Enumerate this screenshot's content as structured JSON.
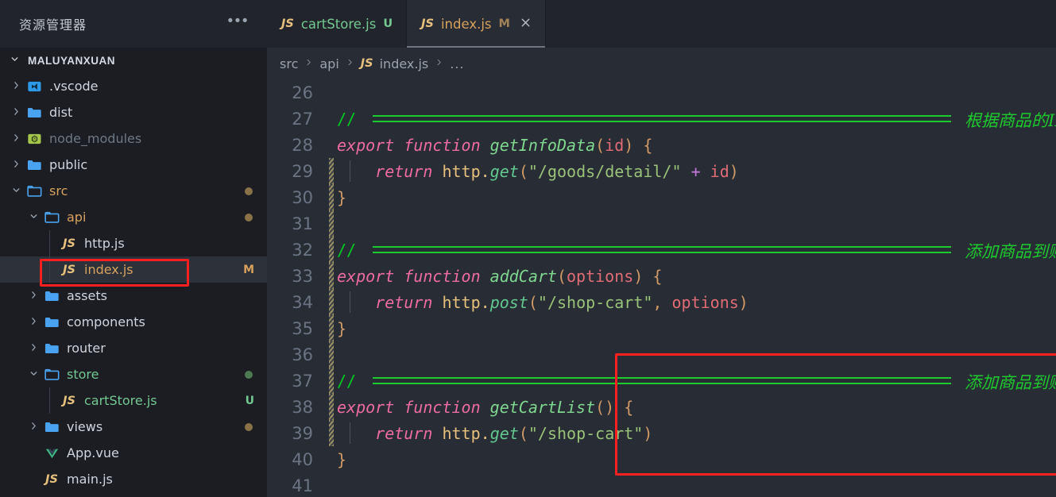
{
  "sidebar": {
    "title": "资源管理器",
    "more_icon": "ellipsis-icon",
    "root_label": "MALUYANXUAN",
    "items": [
      {
        "label": ".vscode",
        "kind": "folder",
        "icon": "vscode-folder-icon",
        "expanded": false,
        "indent": 1,
        "badge": "",
        "dot": ""
      },
      {
        "label": "dist",
        "kind": "folder",
        "icon": "folder-icon",
        "expanded": false,
        "indent": 1,
        "badge": "",
        "dot": ""
      },
      {
        "label": "node_modules",
        "kind": "folder",
        "icon": "node-folder-icon",
        "expanded": false,
        "indent": 1,
        "badge": "",
        "dot": "",
        "dim": true
      },
      {
        "label": "public",
        "kind": "folder",
        "icon": "folder-icon",
        "expanded": false,
        "indent": 1,
        "badge": "",
        "dot": ""
      },
      {
        "label": "src",
        "kind": "folder",
        "icon": "folder-open-icon",
        "expanded": true,
        "indent": 1,
        "badge": "",
        "dot": "amber",
        "mod": true
      },
      {
        "label": "api",
        "kind": "folder",
        "icon": "folder-open-icon",
        "expanded": true,
        "indent": 2,
        "badge": "",
        "dot": "amber",
        "mod": true
      },
      {
        "label": "http.js",
        "kind": "file",
        "icon": "js-file-icon",
        "indent": 3,
        "badge": "",
        "dot": ""
      },
      {
        "label": "index.js",
        "kind": "file",
        "icon": "js-file-icon",
        "indent": 3,
        "badge": "M",
        "badge_kind": "m",
        "dot": "",
        "selected": true,
        "mod": true
      },
      {
        "label": "assets",
        "kind": "folder",
        "icon": "folder-icon",
        "expanded": false,
        "indent": 2,
        "badge": "",
        "dot": ""
      },
      {
        "label": "components",
        "kind": "folder",
        "icon": "folder-icon",
        "expanded": false,
        "indent": 2,
        "badge": "",
        "dot": ""
      },
      {
        "label": "router",
        "kind": "folder",
        "icon": "folder-icon",
        "expanded": false,
        "indent": 2,
        "badge": "",
        "dot": ""
      },
      {
        "label": "store",
        "kind": "folder",
        "icon": "folder-open-icon",
        "expanded": true,
        "indent": 2,
        "badge": "",
        "dot": "green",
        "untracked": true
      },
      {
        "label": "cartStore.js",
        "kind": "file",
        "icon": "js-file-icon",
        "indent": 3,
        "badge": "U",
        "badge_kind": "u",
        "dot": "",
        "untracked": true
      },
      {
        "label": "views",
        "kind": "folder",
        "icon": "folder-icon",
        "expanded": false,
        "indent": 2,
        "badge": "",
        "dot": "amber"
      },
      {
        "label": "App.vue",
        "kind": "file",
        "icon": "vue-file-icon",
        "indent": 2,
        "badge": "",
        "dot": ""
      },
      {
        "label": "main.js",
        "kind": "file",
        "icon": "js-file-icon",
        "indent": 2,
        "badge": "",
        "dot": ""
      }
    ]
  },
  "tabs": [
    {
      "icon": "js-file-icon",
      "name": "cartStore.js",
      "badge": "U",
      "badge_kind": "u",
      "active": false,
      "closable": false
    },
    {
      "icon": "js-file-icon",
      "name": "index.js",
      "badge": "M",
      "badge_kind": "m",
      "active": true,
      "closable": true,
      "close_icon": "close-icon"
    }
  ],
  "breadcrumb": {
    "parts": [
      "src",
      "api",
      "index.js"
    ],
    "file_icon": "js-file-icon",
    "separator": "›",
    "trailing": "..."
  },
  "editor": {
    "lines": [
      {
        "num": "26",
        "code": "",
        "changed": false
      },
      {
        "num": "27",
        "code": "// ",
        "changed": false,
        "comment_cjk": "根据商品的ID，获取商品的详情",
        "eq_rule": true
      },
      {
        "num": "28",
        "code": "export function getInfoData(id) {",
        "changed": false
      },
      {
        "num": "29",
        "code": "    return http.get(\"/goods/detail/\" + id)",
        "changed": true,
        "indent_guide": true
      },
      {
        "num": "30",
        "code": "}",
        "changed": true
      },
      {
        "num": "31",
        "code": "",
        "changed": true
      },
      {
        "num": "32",
        "code": "// ",
        "changed": true,
        "comment_cjk": "添加商品到购物车",
        "eq_rule": true
      },
      {
        "num": "33",
        "code": "export function addCart(options) {",
        "changed": true
      },
      {
        "num": "34",
        "code": "    return http.post(\"/shop-cart\", options)",
        "changed": true,
        "indent_guide": true
      },
      {
        "num": "35",
        "code": "}",
        "changed": true
      },
      {
        "num": "36",
        "code": "",
        "changed": true
      },
      {
        "num": "37",
        "code": "// ",
        "changed": true,
        "comment_cjk": "添加商品到购物车",
        "eq_rule": true
      },
      {
        "num": "38",
        "code": "export function getCartList() {",
        "changed": true
      },
      {
        "num": "39",
        "code": "    return http.get(\"/shop-cart\")",
        "changed": true,
        "indent_guide": true
      },
      {
        "num": "40",
        "code": "}",
        "changed": false
      },
      {
        "num": "41",
        "code": "",
        "changed": false
      }
    ]
  },
  "annotations": {
    "highlight_color": "#fb1f1f",
    "sidebar_box_target": "index.js",
    "code_box_lines": [
      "37",
      "38",
      "39",
      "40"
    ]
  },
  "colors": {
    "sidebar_bg": "#1b1d23",
    "editor_bg": "#282c34",
    "chrome_bg": "#21252b",
    "selection_bg": "#2c313a",
    "modified": "#d8a25d",
    "untracked": "#73c991",
    "comment_green": "#1ecb2e"
  }
}
